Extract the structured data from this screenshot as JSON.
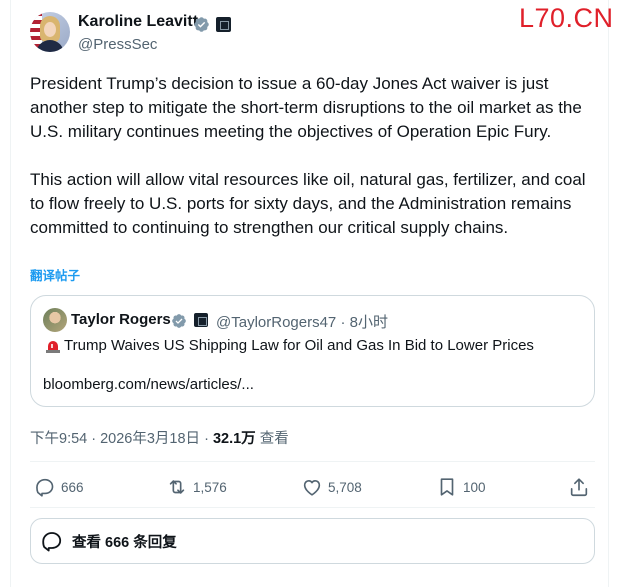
{
  "author": {
    "name": "Karoline Leavitt",
    "handle": "@PressSec"
  },
  "watermark": "L70.CN",
  "tweet": {
    "paragraphs": [
      "President Trump’s decision to issue a 60-day Jones Act waiver is just another step to mitigate the short-term disruptions to the oil market as the U.S. military continues meeting the objectives of Operation Epic Fury.",
      "This action will allow vital resources like oil, natural gas, fertilizer, and coal to flow freely to U.S. ports for sixty days, and the Administration remains committed to continuing to strengthen our critical supply chains."
    ],
    "translate_label": "翻译帖子"
  },
  "quote": {
    "name": "Taylor Rogers",
    "meta": "@TaylorRogers47 · 8小时",
    "headline": "Trump Waives US Shipping Law for Oil and Gas In Bid to Lower Prices",
    "link": "bloomberg.com/news/articles/..."
  },
  "meta": {
    "time_date": "下午9:54 · 2026年3月18日 · ",
    "views_count": "32.1万",
    "views_label": " 查看"
  },
  "actions": {
    "replies": "666",
    "reposts": "1,576",
    "likes": "5,708",
    "bookmarks": "100"
  },
  "replies_box": {
    "label": "查看 666 条回复"
  },
  "colors": {
    "accent": "#1d9bf0",
    "text": "#0f1419",
    "muted": "#536471",
    "watermark": "#e0202a"
  }
}
